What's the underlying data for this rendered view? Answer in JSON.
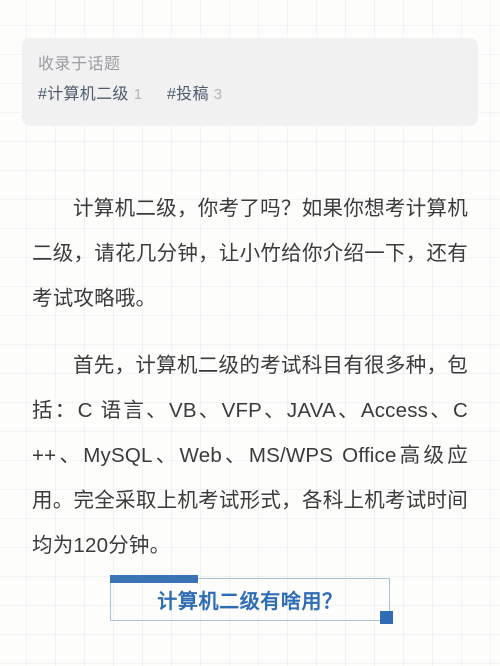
{
  "colors": {
    "page_background": "#fcfcfb",
    "grid_line": "rgba(120,140,160,0.085)",
    "topic_card_background": "#f1f1f2",
    "topic_caption_text": "#9b9ba1",
    "tag_text": "#4f5a6e",
    "tag_count_text": "#b4b4ba",
    "body_text": "#3b3b3b",
    "heading_accent_blue": "#2f6cb5",
    "heading_border_blue": "#a9c2da",
    "heading_text_blue": "#2e6db4"
  },
  "topic_card": {
    "caption": "收录于话题",
    "tags": [
      {
        "name": "#计算机二级",
        "count": "1"
      },
      {
        "name": "#投稿",
        "count": "3"
      }
    ]
  },
  "article": {
    "paragraphs": [
      "计算机二级，你考了吗？如果你想考计算机二级，请花几分钟，让小竹给你介绍一下，还有考试攻略哦。",
      "首先，计算机二级的考试科目有很多种，包括：C 语言、VB、VFP、JAVA、Access、C ++、MySQL、Web、MS/WPS Office高级应用。完全采取上机考试形式，各科上机考试时间均为120分钟。"
    ],
    "section_heading": "计算机二级有啥用？"
  }
}
